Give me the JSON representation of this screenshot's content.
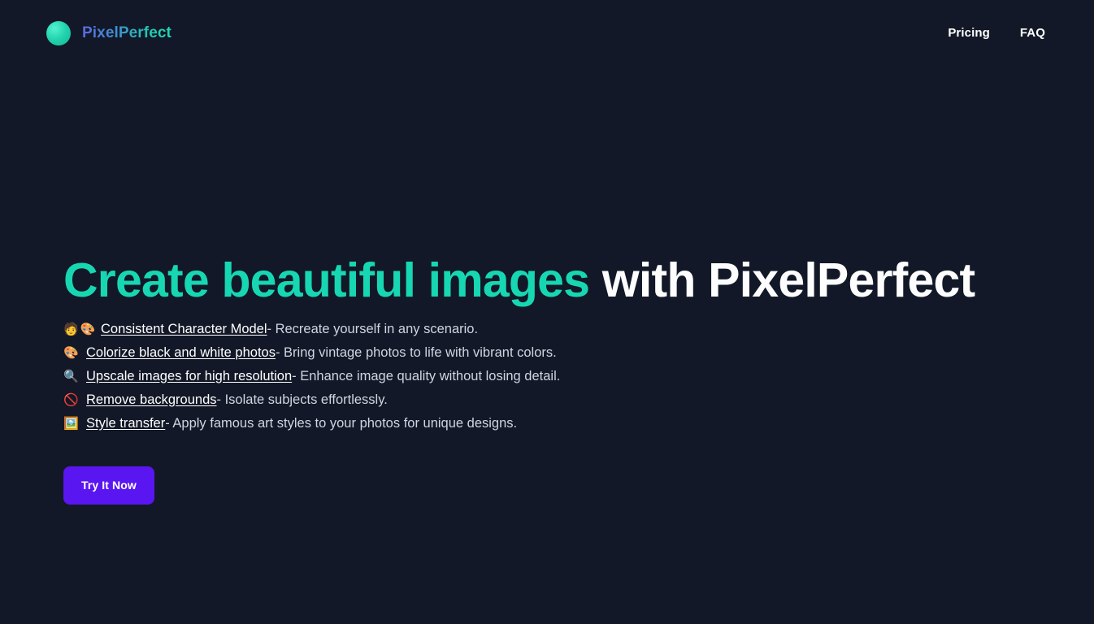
{
  "page": {
    "background_color": "#121827",
    "accent_teal": "#17d7b2",
    "accent_violet": "#5a16f0"
  },
  "header": {
    "brand": {
      "logo_icon": "gradient-circle-logo",
      "name": "PixelPerfect"
    },
    "nav": [
      {
        "label": "Pricing"
      },
      {
        "label": "FAQ"
      }
    ]
  },
  "hero": {
    "title_accent": "Create beautiful images",
    "title_plain": " with PixelPerfect",
    "features": [
      {
        "emojis": "🧑🎨",
        "emoji_names": "person-icon palette-icon",
        "link": "Consistent Character Model",
        "desc": " - Recreate yourself in any scenario."
      },
      {
        "emojis": "🎨",
        "emoji_names": "palette-icon",
        "link": "Colorize black and white photos",
        "desc": " - Bring vintage photos to life with vibrant colors."
      },
      {
        "emojis": "🔍",
        "emoji_names": "magnifier-icon",
        "link": "Upscale images for high resolution",
        "desc": " - Enhance image quality without losing detail."
      },
      {
        "emojis": "🚫",
        "emoji_names": "prohibited-icon",
        "link": "Remove backgrounds",
        "desc": " - Isolate subjects effortlessly."
      },
      {
        "emojis": "🖼️",
        "emoji_names": "framed-picture-icon",
        "link": "Style transfer",
        "desc": " - Apply famous art styles to your photos for unique designs."
      }
    ],
    "cta_label": "Try It Now"
  }
}
